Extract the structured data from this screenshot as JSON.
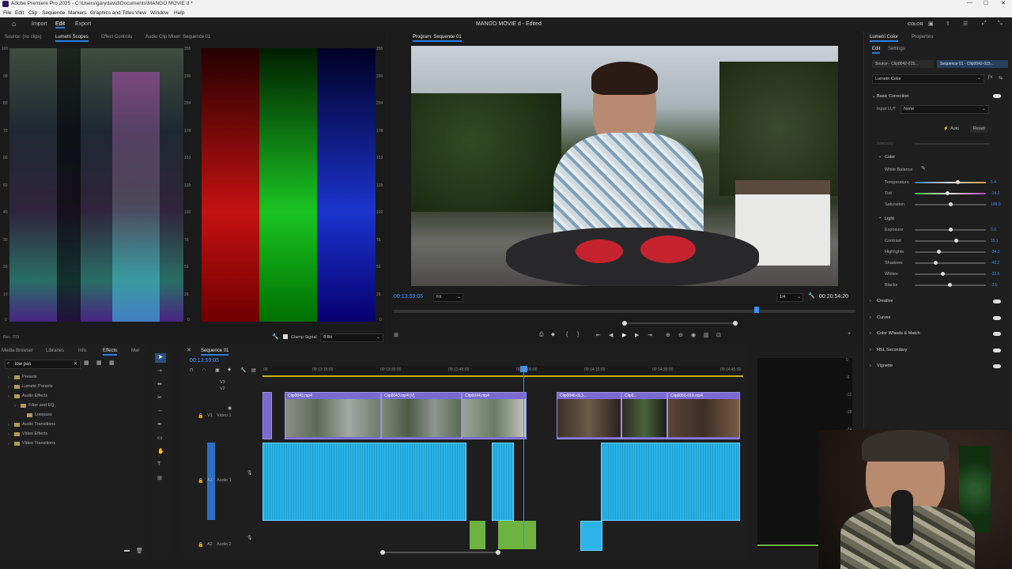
{
  "window": {
    "title": "Adobe Premiere Pro 2025 - C:\\Users\\garydavid\\Documents\\MANGO MOVIE d *"
  },
  "menu": [
    "File",
    "Edit",
    "Clip",
    "Sequence",
    "Markers",
    "Graphics and Titles",
    "View",
    "Window",
    "Help"
  ],
  "workspace": {
    "tabs": [
      "Import",
      "Edit",
      "Export"
    ],
    "active": "Edit",
    "project_title": "MANGO MOVIE d - Edited",
    "right_label": "COLOR"
  },
  "scopes_panel": {
    "tabs": [
      "Source: (no clips)",
      "Lumetri Scopes",
      "Effect Controls",
      "Audio Clip Mixer: Sequence 01"
    ],
    "active": "Lumetri Scopes",
    "left_ticks": [
      "100",
      "90",
      "80",
      "70",
      "60",
      "50",
      "40",
      "30",
      "20",
      "10",
      "0"
    ],
    "mid_ticks": [
      "255",
      "230",
      "204",
      "178",
      "153",
      "128",
      "102",
      "76",
      "51",
      "26",
      "0"
    ],
    "right_ticks": [
      "255",
      "230",
      "204",
      "178",
      "153",
      "128",
      "102",
      "76",
      "51",
      "26",
      "0"
    ],
    "footer_left": "Rec. 709",
    "clamp_label": "Clamp Signal",
    "bit_value": "8 Bit"
  },
  "program": {
    "tab": "Program: Sequence 01",
    "timecode": "00:13:59:05",
    "fit": "Fit",
    "quality": "1/4",
    "duration": "00:20:54:20"
  },
  "lumetri": {
    "tabs": [
      "Lumetri Color",
      "Properties"
    ],
    "subtabs": [
      "Edit",
      "Settings"
    ],
    "source_label": "Source - Clip0042-015...",
    "sequence_label": "Sequence 01 - Clip0042-015...",
    "effect": "Lumetri Color",
    "basic_correction": "Basic Correction",
    "input_lut_label": "Input LUT",
    "input_lut_value": "None",
    "auto": "Auto",
    "reset": "Reset",
    "intensity": "Intensity",
    "color_section": "Color",
    "white_balance": "White Balance",
    "light_section": "Light",
    "sliders": [
      {
        "label": "Temperature",
        "value": "5.4",
        "pos": 0.6
      },
      {
        "label": "Tint",
        "value": "-14.2",
        "pos": 0.45
      },
      {
        "label": "Saturation",
        "value": "100.0",
        "pos": 0.5
      },
      {
        "label": "Exposure",
        "value": "0.0",
        "pos": 0.5
      },
      {
        "label": "Contrast",
        "value": "15.1",
        "pos": 0.58
      },
      {
        "label": "Highlights",
        "value": "-34.0",
        "pos": 0.33
      },
      {
        "label": "Shadows",
        "value": "-42.2",
        "pos": 0.29
      },
      {
        "label": "Whites",
        "value": "-22.6",
        "pos": 0.39
      },
      {
        "label": "Blacks",
        "value": "-2.0",
        "pos": 0.49
      }
    ],
    "sections": [
      "Creative",
      "Curves",
      "Color Wheels & Match",
      "HSL Secondary",
      "Vignette"
    ]
  },
  "project_panel": {
    "tabs": [
      "Media Browser",
      "Libraries",
      "Info",
      "Effects",
      "Mar"
    ],
    "active": "Effects",
    "search": "low pas",
    "tree": [
      {
        "label": "Presets",
        "indent": 0
      },
      {
        "label": "Lumetri Presets",
        "indent": 0
      },
      {
        "label": "Audio Effects",
        "indent": 0
      },
      {
        "label": "Filter and EQ",
        "indent": 1
      },
      {
        "label": "Lowpass",
        "indent": 2
      },
      {
        "label": "Audio Transitions",
        "indent": 0
      },
      {
        "label": "Video Effects",
        "indent": 0
      },
      {
        "label": "Video Transitions",
        "indent": 0
      }
    ]
  },
  "timeline": {
    "tab": "Sequence 01",
    "timecode": "00:13:59:05",
    "ruler": [
      "00",
      "00:13:15:00",
      "00:13:30:00",
      "00:13:45:00",
      "00:14:00:00",
      "00:14:15:00",
      "00:14:30:00",
      "00:14:45:00"
    ],
    "tracks": [
      "V3",
      "V2",
      "V1",
      "A1",
      "A2"
    ],
    "video_track_name": "Video 1",
    "audio1_name": "Audio 1",
    "audio2_name": "Audio 2",
    "clip_labels": [
      "Clip0043.mp4",
      "Clip0043.mp4 [V]",
      "Clip0044.mp4",
      "Clip0046-013...",
      "Clip0...",
      "Clip0050...",
      "Clip0050-019.mp4"
    ]
  },
  "meter_ticks": [
    "0",
    "-6",
    "-12",
    "-18",
    "-24",
    "-30",
    "-36",
    "-42",
    "-48",
    "-54",
    "dB"
  ],
  "colors": {
    "accent": "#2680eb",
    "audio": "#2bb3e8",
    "video": "#7a6ad0",
    "green": "#6db33f"
  }
}
